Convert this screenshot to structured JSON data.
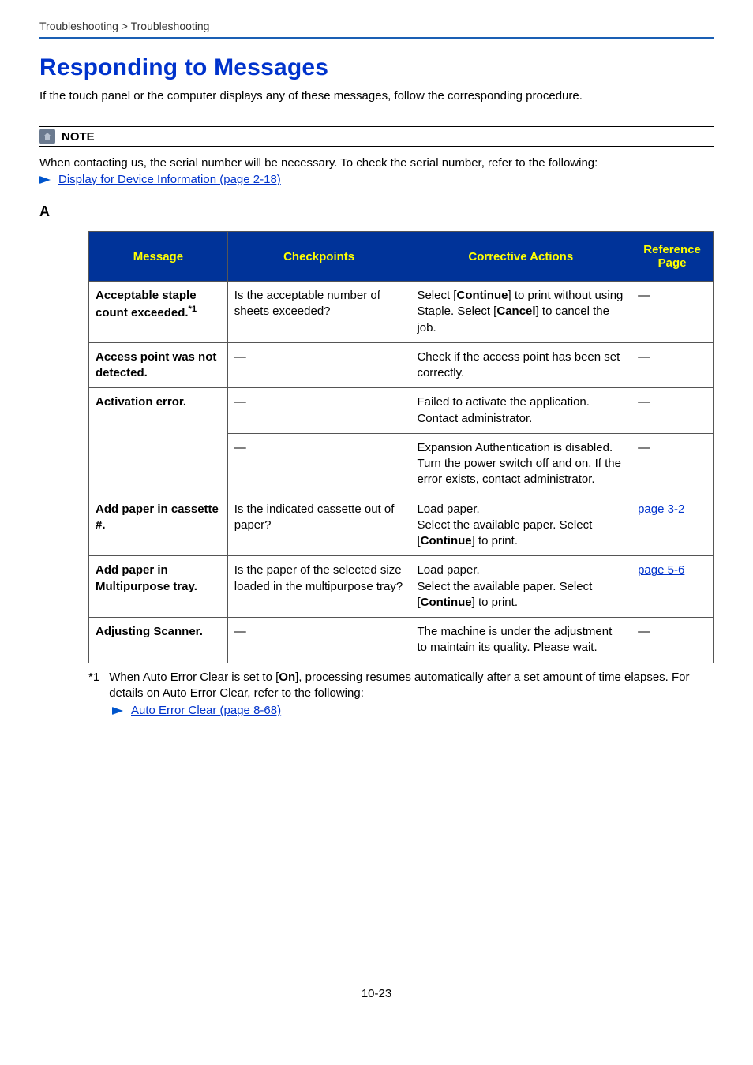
{
  "breadcrumb": "Troubleshooting > Troubleshooting",
  "heading": "Responding to Messages",
  "intro": "If the touch panel or the computer displays any of these messages, follow the corresponding procedure.",
  "note": {
    "label": "NOTE",
    "body": "When contacting us, the serial number will be necessary. To check the serial number, refer to the following:",
    "link": "Display for Device Information (page 2-18)"
  },
  "section_letter": "A",
  "table": {
    "headers": {
      "message": "Message",
      "checkpoints": "Checkpoints",
      "actions": "Corrective Actions",
      "reference": "Reference Page"
    },
    "rows": [
      {
        "message_pre": "Acceptable staple count exceeded.",
        "message_sup": "*1",
        "checkpoints": "Is the acceptable number of sheets exceeded?",
        "actions_html": "Select [<b>Continue</b>] to print without using Staple. Select [<b>Cancel</b>] to cancel the job.",
        "reference": "―",
        "ref_is_link": false,
        "row_span_msg": 1
      },
      {
        "message_pre": "Access point was not detected.",
        "message_sup": "",
        "checkpoints": "―",
        "actions_html": "Check if the access point has been set correctly.",
        "reference": "―",
        "ref_is_link": false,
        "row_span_msg": 1
      },
      {
        "message_pre": "Activation error.",
        "message_sup": "",
        "checkpoints": "―",
        "actions_html": "Failed to activate the application. Contact administrator.",
        "reference": "―",
        "ref_is_link": false,
        "row_span_msg": 2
      },
      {
        "message_pre": "",
        "message_sup": "",
        "checkpoints": "―",
        "actions_html": "Expansion Authentication is disabled. Turn the power switch off and on. If the error exists, contact administrator.",
        "reference": "―",
        "ref_is_link": false,
        "skip_msg": true
      },
      {
        "message_pre": "Add paper in cassette #.",
        "message_sup": "",
        "checkpoints": "Is the indicated cassette out of paper?",
        "actions_html": "Load paper.<br>Select the available paper. Select [<b>Continue</b>] to print.",
        "reference": "page 3-2",
        "ref_is_link": true,
        "row_span_msg": 1
      },
      {
        "message_pre": "Add paper in Multipurpose tray.",
        "message_sup": "",
        "checkpoints": "Is the paper of the selected size loaded in the multipurpose tray?",
        "actions_html": "Load paper.<br>Select the available paper. Select [<b>Continue</b>] to print.",
        "reference": "page 5-6",
        "ref_is_link": true,
        "row_span_msg": 1
      },
      {
        "message_pre": "Adjusting Scanner.",
        "message_sup": "",
        "checkpoints": "―",
        "actions_html": "The machine is under the adjustment to maintain its quality. Please wait.",
        "reference": "―",
        "ref_is_link": false,
        "row_span_msg": 1
      }
    ]
  },
  "footnote": {
    "key": "*1",
    "text_html": "When Auto Error Clear is set to [<b>On</b>], processing resumes automatically after a set amount of time elapses. For details on Auto Error Clear, refer to the following:",
    "link": "Auto Error Clear (page 8-68)"
  },
  "page_number": "10-23",
  "chart_data": {
    "type": "table",
    "title": "Responding to Messages — Section A",
    "columns": [
      "Message",
      "Checkpoints",
      "Corrective Actions",
      "Reference Page"
    ],
    "rows": [
      [
        "Acceptable staple count exceeded.*1",
        "Is the acceptable number of sheets exceeded?",
        "Select [Continue] to print without using Staple. Select [Cancel] to cancel the job.",
        "―"
      ],
      [
        "Access point was not detected.",
        "―",
        "Check if the access point has been set correctly.",
        "―"
      ],
      [
        "Activation error.",
        "―",
        "Failed to activate the application. Contact administrator.",
        "―"
      ],
      [
        "Activation error.",
        "―",
        "Expansion Authentication is disabled. Turn the power switch off and on. If the error exists, contact administrator.",
        "―"
      ],
      [
        "Add paper in cassette #.",
        "Is the indicated cassette out of paper?",
        "Load paper. Select the available paper. Select [Continue] to print.",
        "page 3-2"
      ],
      [
        "Add paper in Multipurpose tray.",
        "Is the paper of the selected size loaded in the multipurpose tray?",
        "Load paper. Select the available paper. Select [Continue] to print.",
        "page 5-6"
      ],
      [
        "Adjusting Scanner.",
        "―",
        "The machine is under the adjustment to maintain its quality. Please wait.",
        "―"
      ]
    ]
  }
}
